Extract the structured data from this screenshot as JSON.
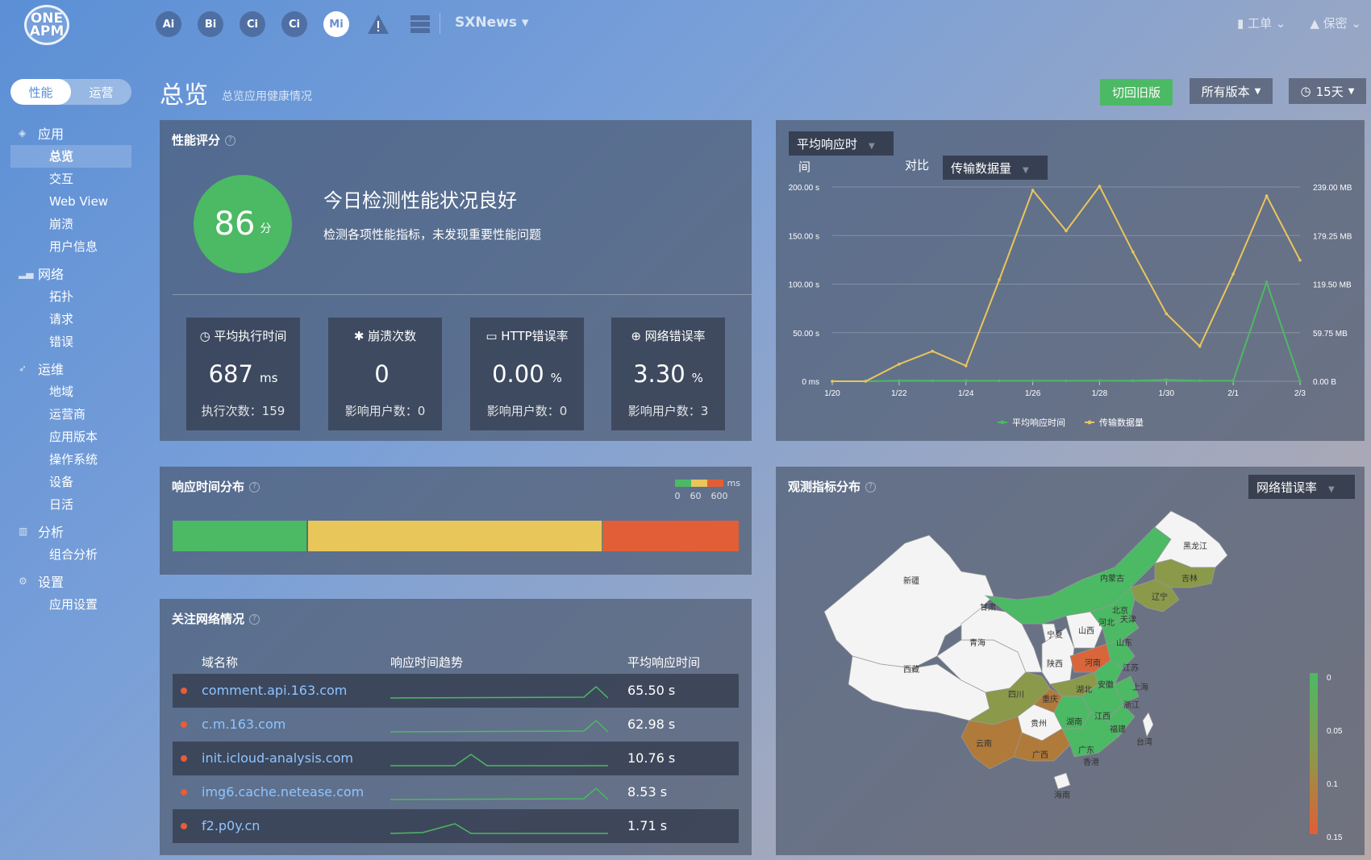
{
  "topbar": {
    "logo_line1": "ONE",
    "logo_line2": "APM",
    "products": [
      "Ai",
      "Bi",
      "Ci",
      "Ci",
      "Mi"
    ],
    "app_name": "SXNews ▾",
    "ticket": "工单 ⌄",
    "user": "保密 ⌄"
  },
  "mode": {
    "perf": "性能",
    "ops": "运营"
  },
  "sidebar": {
    "app": {
      "label": "应用",
      "items": [
        "总览",
        "交互",
        "Web View",
        "崩溃",
        "用户信息"
      ]
    },
    "network": {
      "label": "网络",
      "items": [
        "拓扑",
        "请求",
        "错误"
      ]
    },
    "ops": {
      "label": "运维",
      "items": [
        "地域",
        "运营商",
        "应用版本",
        "操作系统",
        "设备",
        "日活"
      ]
    },
    "analysis": {
      "label": "分析",
      "items": [
        "组合分析"
      ]
    },
    "settings": {
      "label": "设置",
      "items": [
        "应用设置"
      ]
    }
  },
  "header": {
    "title": "总览",
    "subtitle": "总览应用健康情况",
    "btn_old": "切回旧版",
    "btn_version": "所有版本",
    "btn_days": "15天"
  },
  "score": {
    "title": "性能评分",
    "value": "86",
    "unit": "分",
    "headline": "今日检测性能状况良好",
    "desc": "检测各项性能指标，未发现重要性能问题",
    "metrics": [
      {
        "label": "平均执行时间",
        "value": "687",
        "unit": "ms",
        "sub": "执行次数：159"
      },
      {
        "label": "崩溃次数",
        "value": "0",
        "unit": "",
        "sub": "影响用户数：0"
      },
      {
        "label": "HTTP错误率",
        "value": "0.00",
        "unit": "%",
        "sub": "影响用户数：0"
      },
      {
        "label": "网络错误率",
        "value": "3.30",
        "unit": "%",
        "sub": "影响用户数：3"
      }
    ]
  },
  "dist": {
    "title": "响应时间分布",
    "unit": "ms",
    "ticks": [
      "0",
      "60",
      "600"
    ],
    "fractions": [
      0.24,
      0.52,
      0.24
    ],
    "colors": {
      "good": "#4cb964",
      "mid": "#e9c65a",
      "bad": "#e25e37"
    }
  },
  "network": {
    "title": "关注网络情况",
    "cols": [
      "域名称",
      "响应时间趋势",
      "平均响应时间"
    ],
    "rows": [
      {
        "domain": "comment.api.163.com",
        "avg": "65.50 s"
      },
      {
        "domain": "c.m.163.com",
        "avg": "62.98 s"
      },
      {
        "domain": "init.icloud-analysis.com",
        "avg": "10.76 s"
      },
      {
        "domain": "img6.cache.netease.com",
        "avg": "8.53 s"
      },
      {
        "domain": "f2.p0y.cn",
        "avg": "1.71 s"
      }
    ]
  },
  "chart_dd": {
    "metric_a1": "平均响应时",
    "metric_a2": "间",
    "compare": "对比",
    "metric_b": "传输数据量"
  },
  "chart_data": {
    "type": "line",
    "x": [
      "1/20",
      "1/21",
      "1/22",
      "1/23",
      "1/24",
      "1/25",
      "1/26",
      "1/27",
      "1/28",
      "1/29",
      "1/30",
      "1/31",
      "2/1",
      "2/2",
      "2/3"
    ],
    "x_ticks": [
      "1/20",
      "1/22",
      "1/24",
      "1/26",
      "1/28",
      "1/30",
      "2/1",
      "2/3"
    ],
    "y_left_ticks": [
      "200.00 s",
      "150.00 s",
      "100.00 s",
      "50.00 s",
      "0 ms"
    ],
    "y_right_ticks": [
      "239.00 MB",
      "179.25 MB",
      "119.50 MB",
      "59.75 MB",
      "0.00 B"
    ],
    "ylim_left": [
      0,
      200
    ],
    "ylim_right": [
      0,
      239
    ],
    "series": [
      {
        "name": "平均响应时间",
        "axis": "left",
        "color": "#4cb964",
        "values": [
          0,
          0,
          0.5,
          0.5,
          0.5,
          0.5,
          0.5,
          0.5,
          0.5,
          0.5,
          1.5,
          0.5,
          0.5,
          102,
          0
        ]
      },
      {
        "name": "传输数据量",
        "axis": "right",
        "color": "#e9c65a",
        "values": [
          0,
          0,
          21,
          37,
          19,
          125,
          235,
          185,
          240,
          159,
          83,
          43,
          132,
          228,
          149
        ]
      }
    ],
    "legend_position": "bottom"
  },
  "map": {
    "title": "观测指标分布",
    "dropdown": "网络错误率",
    "legend": [
      "0",
      "0.05",
      "0.1",
      "0.15"
    ],
    "provinces": [
      "黑龙江",
      "吉林",
      "辽宁",
      "内蒙古",
      "北京",
      "天津",
      "河北",
      "新疆",
      "甘肃",
      "宁夏",
      "山西",
      "山东",
      "青海",
      "陕西",
      "河南",
      "江苏",
      "西藏",
      "四川",
      "湖北",
      "安徽",
      "上海",
      "重庆",
      "浙江",
      "江西",
      "贵州",
      "湖南",
      "福建",
      "云南",
      "广西",
      "广东",
      "台湾",
      "香港",
      "海南"
    ],
    "colors": {
      "white": "#f4f4f4",
      "green": "#4cb964",
      "olive": "#8a9a4a",
      "brown": "#b07a3a",
      "orange": "#d8663a"
    }
  }
}
